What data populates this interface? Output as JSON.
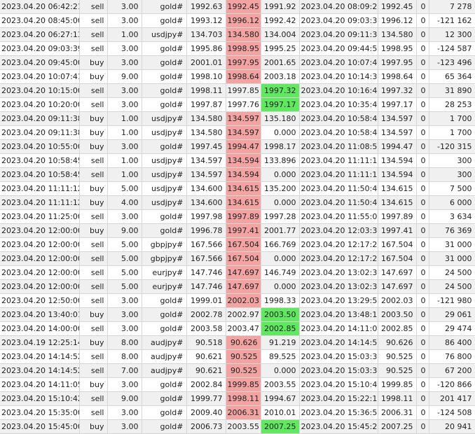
{
  "highlight_colors": {
    "red": "#f4a3a3",
    "green": "#61e861"
  },
  "rows": [
    {
      "open_time": "2023.04.20 06:42:21",
      "type": "sell",
      "volume": "3.00",
      "symbol": "gold#",
      "open_price": "1992.63",
      "sl": "1992.45",
      "tp": "1991.92",
      "close_time": "2023.04.20 08:09:26",
      "close_price": "1992.45",
      "commission": "0",
      "profit": "7 278",
      "hl": "sl-red"
    },
    {
      "open_time": "2023.04.20 08:45:00",
      "type": "sell",
      "volume": "3.00",
      "symbol": "gold#",
      "open_price": "1993.12",
      "sl": "1996.12",
      "tp": "1992.42",
      "close_time": "2023.04.20 09:03:39",
      "close_price": "1996.12",
      "commission": "0",
      "profit": "-121 162",
      "hl": "sl-red"
    },
    {
      "open_time": "2023.04.20 06:27:13",
      "type": "sell",
      "volume": "1.00",
      "symbol": "usdjpy#",
      "open_price": "134.703",
      "sl": "134.580",
      "tp": "134.004",
      "close_time": "2023.04.20 09:11:38",
      "close_price": "134.580",
      "commission": "0",
      "profit": "12 300",
      "hl": "sl-red"
    },
    {
      "open_time": "2023.04.20 09:03:39",
      "type": "sell",
      "volume": "3.00",
      "symbol": "gold#",
      "open_price": "1995.86",
      "sl": "1998.95",
      "tp": "1995.25",
      "close_time": "2023.04.20 09:44:59",
      "close_price": "1998.95",
      "commission": "0",
      "profit": "-124 587",
      "hl": "sl-red"
    },
    {
      "open_time": "2023.04.20 09:45:00",
      "type": "buy",
      "volume": "3.00",
      "symbol": "gold#",
      "open_price": "2001.01",
      "sl": "1997.95",
      "tp": "2001.65",
      "close_time": "2023.04.20 10:07:41",
      "close_price": "1997.95",
      "commission": "0",
      "profit": "-123 496",
      "hl": "sl-red"
    },
    {
      "open_time": "2023.04.20 10:07:41",
      "type": "buy",
      "volume": "9.00",
      "symbol": "gold#",
      "open_price": "1998.10",
      "sl": "1998.64",
      "tp": "2003.18",
      "close_time": "2023.04.20 10:14:32",
      "close_price": "1998.64",
      "commission": "0",
      "profit": "65 364",
      "hl": "sl-red"
    },
    {
      "open_time": "2023.04.20 10:15:00",
      "type": "sell",
      "volume": "3.00",
      "symbol": "gold#",
      "open_price": "1998.11",
      "sl": "1997.85",
      "tp": "1997.32",
      "close_time": "2023.04.20 10:16:44",
      "close_price": "1997.32",
      "commission": "0",
      "profit": "31 890",
      "hl": "tp-green"
    },
    {
      "open_time": "2023.04.20 10:20:00",
      "type": "sell",
      "volume": "3.00",
      "symbol": "gold#",
      "open_price": "1997.87",
      "sl": "1997.76",
      "tp": "1997.17",
      "close_time": "2023.04.20 10:35:48",
      "close_price": "1997.17",
      "commission": "0",
      "profit": "28 253",
      "hl": "tp-green"
    },
    {
      "open_time": "2023.04.20 09:11:38",
      "type": "buy",
      "volume": "1.00",
      "symbol": "usdjpy#",
      "open_price": "134.580",
      "sl": "134.597",
      "tp": "135.180",
      "close_time": "2023.04.20 10:58:44",
      "close_price": "134.597",
      "commission": "0",
      "profit": "1 700",
      "hl": "sl-red"
    },
    {
      "open_time": "2023.04.20 09:11:38",
      "type": "buy",
      "volume": "1.00",
      "symbol": "usdjpy#",
      "open_price": "134.580",
      "sl": "134.597",
      "tp": "0.000",
      "close_time": "2023.04.20 10:58:44",
      "close_price": "134.597",
      "commission": "0",
      "profit": "1 700",
      "hl": "sl-red"
    },
    {
      "open_time": "2023.04.20 10:55:00",
      "type": "buy",
      "volume": "3.00",
      "symbol": "gold#",
      "open_price": "1997.45",
      "sl": "1994.47",
      "tp": "1998.17",
      "close_time": "2023.04.20 11:08:53",
      "close_price": "1994.47",
      "commission": "0",
      "profit": "-120 315",
      "hl": "sl-red"
    },
    {
      "open_time": "2023.04.20 10:58:45",
      "type": "sell",
      "volume": "1.00",
      "symbol": "usdjpy#",
      "open_price": "134.597",
      "sl": "134.594",
      "tp": "133.896",
      "close_time": "2023.04.20 11:11:12",
      "close_price": "134.594",
      "commission": "0",
      "profit": "300",
      "hl": "sl-red"
    },
    {
      "open_time": "2023.04.20 10:58:45",
      "type": "sell",
      "volume": "1.00",
      "symbol": "usdjpy#",
      "open_price": "134.597",
      "sl": "134.594",
      "tp": "0.000",
      "close_time": "2023.04.20 11:11:12",
      "close_price": "134.594",
      "commission": "0",
      "profit": "300",
      "hl": "sl-red"
    },
    {
      "open_time": "2023.04.20 11:11:12",
      "type": "buy",
      "volume": "5.00",
      "symbol": "usdjpy#",
      "open_price": "134.600",
      "sl": "134.615",
      "tp": "135.200",
      "close_time": "2023.04.20 11:50:48",
      "close_price": "134.615",
      "commission": "0",
      "profit": "7 500",
      "hl": "sl-red"
    },
    {
      "open_time": "2023.04.20 11:11:12",
      "type": "buy",
      "volume": "4.00",
      "symbol": "usdjpy#",
      "open_price": "134.600",
      "sl": "134.615",
      "tp": "0.000",
      "close_time": "2023.04.20 11:50:48",
      "close_price": "134.615",
      "commission": "0",
      "profit": "6 000",
      "hl": "sl-red"
    },
    {
      "open_time": "2023.04.20 11:25:00",
      "type": "sell",
      "volume": "3.00",
      "symbol": "gold#",
      "open_price": "1997.98",
      "sl": "1997.89",
      "tp": "1997.28",
      "close_time": "2023.04.20 11:55:00",
      "close_price": "1997.89",
      "commission": "0",
      "profit": "3 634",
      "hl": "sl-red"
    },
    {
      "open_time": "2023.04.20 12:00:00",
      "type": "buy",
      "volume": "9.00",
      "symbol": "gold#",
      "open_price": "1996.78",
      "sl": "1997.41",
      "tp": "2001.77",
      "close_time": "2023.04.20 12:03:35",
      "close_price": "1997.41",
      "commission": "0",
      "profit": "76 369",
      "hl": "sl-red"
    },
    {
      "open_time": "2023.04.20 12:00:00",
      "type": "sell",
      "volume": "5.00",
      "symbol": "gbpjpy#",
      "open_price": "167.566",
      "sl": "167.504",
      "tp": "166.769",
      "close_time": "2023.04.20 12:17:23",
      "close_price": "167.504",
      "commission": "0",
      "profit": "31 000",
      "hl": "sl-red"
    },
    {
      "open_time": "2023.04.20 12:00:00",
      "type": "sell",
      "volume": "5.00",
      "symbol": "gbpjpy#",
      "open_price": "167.566",
      "sl": "167.504",
      "tp": "0.000",
      "close_time": "2023.04.20 12:17:23",
      "close_price": "167.504",
      "commission": "0",
      "profit": "31 000",
      "hl": "sl-red"
    },
    {
      "open_time": "2023.04.20 12:00:00",
      "type": "sell",
      "volume": "5.00",
      "symbol": "eurjpy#",
      "open_price": "147.746",
      "sl": "147.697",
      "tp": "146.749",
      "close_time": "2023.04.20 13:02:36",
      "close_price": "147.697",
      "commission": "0",
      "profit": "24 500",
      "hl": "sl-red"
    },
    {
      "open_time": "2023.04.20 12:00:00",
      "type": "sell",
      "volume": "5.00",
      "symbol": "eurjpy#",
      "open_price": "147.746",
      "sl": "147.697",
      "tp": "0.000",
      "close_time": "2023.04.20 13:02:36",
      "close_price": "147.697",
      "commission": "0",
      "profit": "24 500",
      "hl": "sl-red"
    },
    {
      "open_time": "2023.04.20 12:50:00",
      "type": "sell",
      "volume": "3.00",
      "symbol": "gold#",
      "open_price": "1999.01",
      "sl": "2002.03",
      "tp": "1998.33",
      "close_time": "2023.04.20 13:29:58",
      "close_price": "2002.03",
      "commission": "0",
      "profit": "-121 980",
      "hl": "sl-red"
    },
    {
      "open_time": "2023.04.20 13:40:01",
      "type": "buy",
      "volume": "3.00",
      "symbol": "gold#",
      "open_price": "2002.78",
      "sl": "2002.97",
      "tp": "2003.50",
      "close_time": "2023.04.20 13:48:15",
      "close_price": "2003.50",
      "commission": "0",
      "profit": "29 061",
      "hl": "tp-green"
    },
    {
      "open_time": "2023.04.20 14:00:00",
      "type": "sell",
      "volume": "3.00",
      "symbol": "gold#",
      "open_price": "2003.58",
      "sl": "2003.47",
      "tp": "2002.85",
      "close_time": "2023.04.20 14:11:04",
      "close_price": "2002.85",
      "commission": "0",
      "profit": "29 474",
      "hl": "tp-green"
    },
    {
      "open_time": "2023.04.19 12:25:14",
      "type": "buy",
      "volume": "8.00",
      "symbol": "audjpy#",
      "open_price": "90.518",
      "sl": "90.626",
      "tp": "91.219",
      "close_time": "2023.04.20 14:14:51",
      "close_price": "90.626",
      "commission": "0",
      "profit": "86 400",
      "hl": "sl-red"
    },
    {
      "open_time": "2023.04.20 14:14:52",
      "type": "sell",
      "volume": "8.00",
      "symbol": "audjpy#",
      "open_price": "90.621",
      "sl": "90.525",
      "tp": "89.525",
      "close_time": "2023.04.20 15:03:32",
      "close_price": "90.525",
      "commission": "0",
      "profit": "76 800",
      "hl": "sl-red"
    },
    {
      "open_time": "2023.04.20 14:14:52",
      "type": "sell",
      "volume": "7.00",
      "symbol": "audjpy#",
      "open_price": "90.621",
      "sl": "90.525",
      "tp": "0.000",
      "close_time": "2023.04.20 15:03:32",
      "close_price": "90.525",
      "commission": "0",
      "profit": "67 200",
      "hl": "sl-red"
    },
    {
      "open_time": "2023.04.20 14:11:05",
      "type": "buy",
      "volume": "3.00",
      "symbol": "gold#",
      "open_price": "2002.84",
      "sl": "1999.85",
      "tp": "2003.55",
      "close_time": "2023.04.20 15:10:42",
      "close_price": "1999.85",
      "commission": "0",
      "profit": "-120 866",
      "hl": "sl-red"
    },
    {
      "open_time": "2023.04.20 15:10:42",
      "type": "sell",
      "volume": "9.00",
      "symbol": "gold#",
      "open_price": "1999.77",
      "sl": "1998.11",
      "tp": "1994.67",
      "close_time": "2023.04.20 15:22:15",
      "close_price": "1998.11",
      "commission": "0",
      "profit": "201 417",
      "hl": "sl-red"
    },
    {
      "open_time": "2023.04.20 15:35:00",
      "type": "sell",
      "volume": "3.00",
      "symbol": "gold#",
      "open_price": "2009.40",
      "sl": "2006.31",
      "tp": "2010.01",
      "close_time": "2023.04.20 15:36:52",
      "close_price": "2006.31",
      "commission": "0",
      "profit": "-124 508",
      "hl": "sl-red"
    },
    {
      "open_time": "2023.04.20 15:45:00",
      "type": "buy",
      "volume": "3.00",
      "symbol": "gold#",
      "open_price": "2006.73",
      "sl": "2003.55",
      "tp": "2007.25",
      "close_time": "2023.04.20 15:45:22",
      "close_price": "2007.25",
      "commission": "0",
      "profit": "20 941",
      "hl": "tp-green"
    }
  ]
}
